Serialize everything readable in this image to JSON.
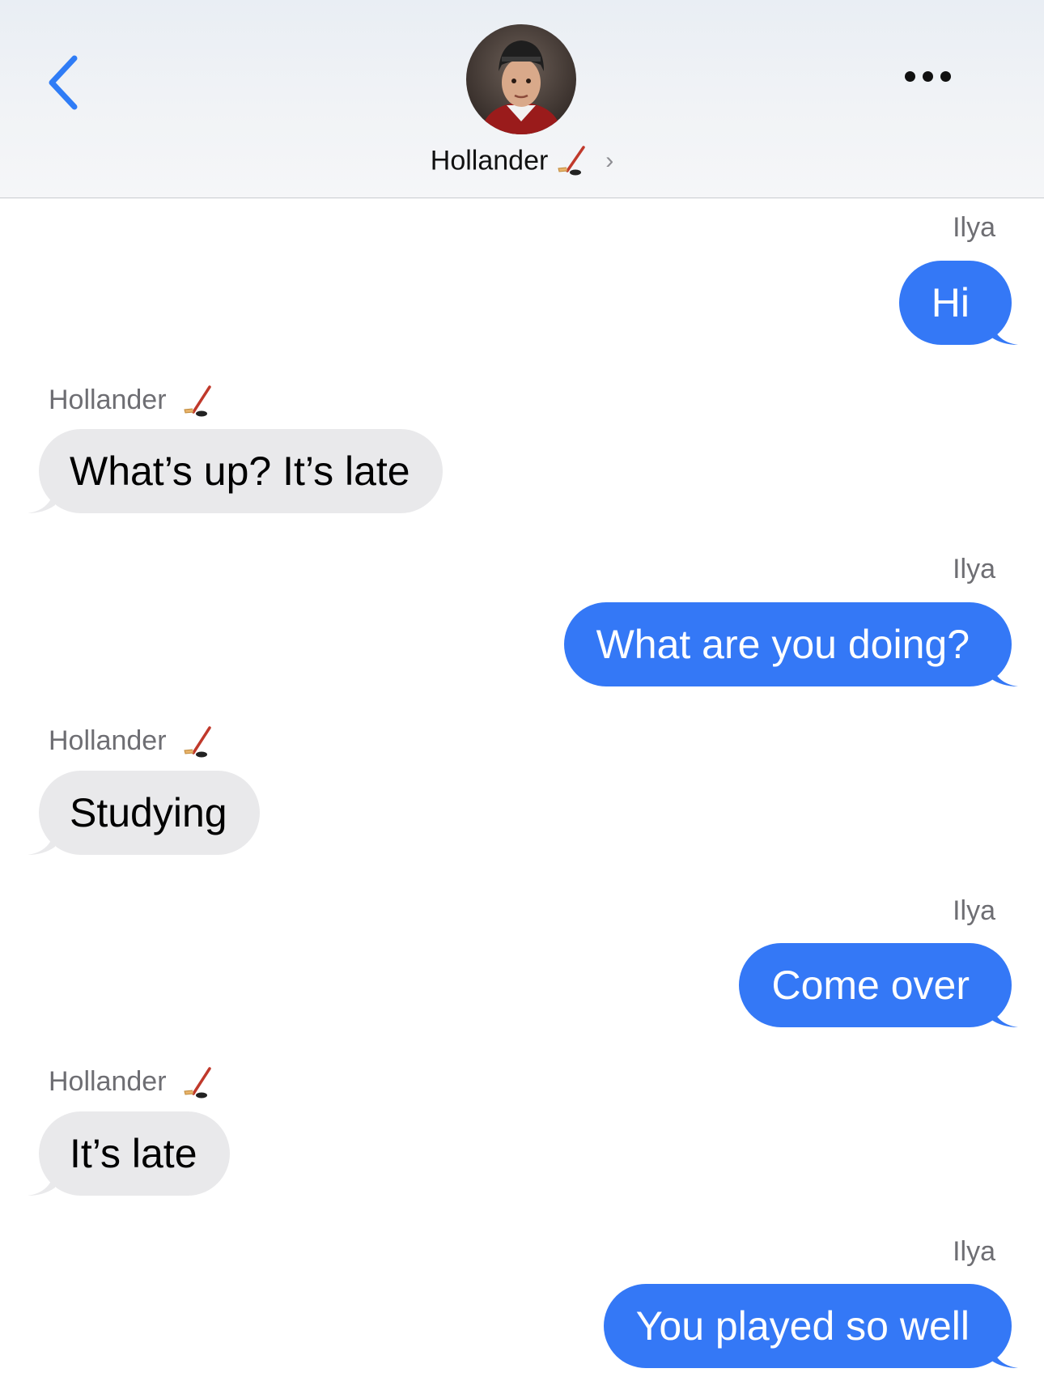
{
  "header": {
    "contact_name": "Hollander",
    "name_emoji": "ice-hockey-icon",
    "back": "chevron-left-icon",
    "more": "more-icon",
    "chevron": "›"
  },
  "colors": {
    "accent": "#3478f6",
    "outgoing_bubble": "#3478f6",
    "incoming_bubble": "#e9e9eb",
    "sender_label": "#6e6e73"
  },
  "messages": [
    {
      "sender": "Ilya",
      "direction": "out",
      "text": "Hi"
    },
    {
      "sender": "Hollander",
      "direction": "in",
      "text": "What’s up? It’s late"
    },
    {
      "sender": "Ilya",
      "direction": "out",
      "text": "What are you doing?"
    },
    {
      "sender": "Hollander",
      "direction": "in",
      "text": "Studying"
    },
    {
      "sender": "Ilya",
      "direction": "out",
      "text": "Come over"
    },
    {
      "sender": "Hollander",
      "direction": "in",
      "text": "It’s late"
    },
    {
      "sender": "Ilya",
      "direction": "out",
      "text": "You played so well"
    }
  ]
}
